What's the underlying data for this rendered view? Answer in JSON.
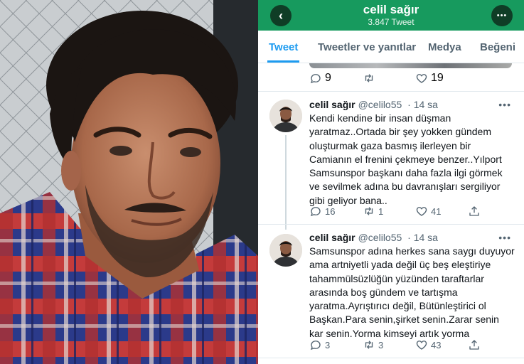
{
  "header": {
    "title": "celil sağır",
    "subtitle": "3.847 Tweet"
  },
  "tabs": [
    {
      "label": "Tweet",
      "active": true
    },
    {
      "label": "Tweetler ve yanıtlar",
      "active": false
    },
    {
      "label": "Medya",
      "active": false
    },
    {
      "label": "Beğeni",
      "active": false
    }
  ],
  "previous_tweet": {
    "replies": "9",
    "retweets": "",
    "likes": "19"
  },
  "tweets": [
    {
      "name": "celil sağır",
      "handle": "@celilo55",
      "time": "· 14 sa",
      "text": "Kendi kendine bir insan düşman yaratmaz..Ortada bir şey yokken gündem oluşturmak gaza basmış ilerleyen bir Camianın el frenini çekmeye benzer..Yılport Samsunspor başkanı daha fazla ilgi görmek ve sevilmek adına bu davranışları sergiliyor gibi geliyor bana..",
      "replies": "16",
      "retweets": "1",
      "likes": "41"
    },
    {
      "name": "celil sağır",
      "handle": "@celilo55",
      "time": "· 14 sa",
      "text": "Samsunspor adına herkes sana saygı duyuyor ama artniyetli yada değil üç beş eleştiriye tahammülsüzlüğün yüzünden taraftarlar arasında boş gündem ve tartışma yaratma.Ayrıştırıcı değil, Bütünleştirici ol Başkan.Para senin,şirket senin.Zarar senin kar senin.Yorma kimseyi artık yorma",
      "replies": "3",
      "retweets": "3",
      "likes": "43"
    }
  ],
  "icons": {
    "back": "arrow-left-icon",
    "more": "more-horizontal-icon",
    "reply": "reply-icon",
    "retweet": "retweet-icon",
    "like": "heart-icon",
    "share": "share-icon"
  },
  "colors": {
    "header_bg": "#179a5e",
    "accent": "#1d9bf0",
    "muted": "#536471"
  }
}
